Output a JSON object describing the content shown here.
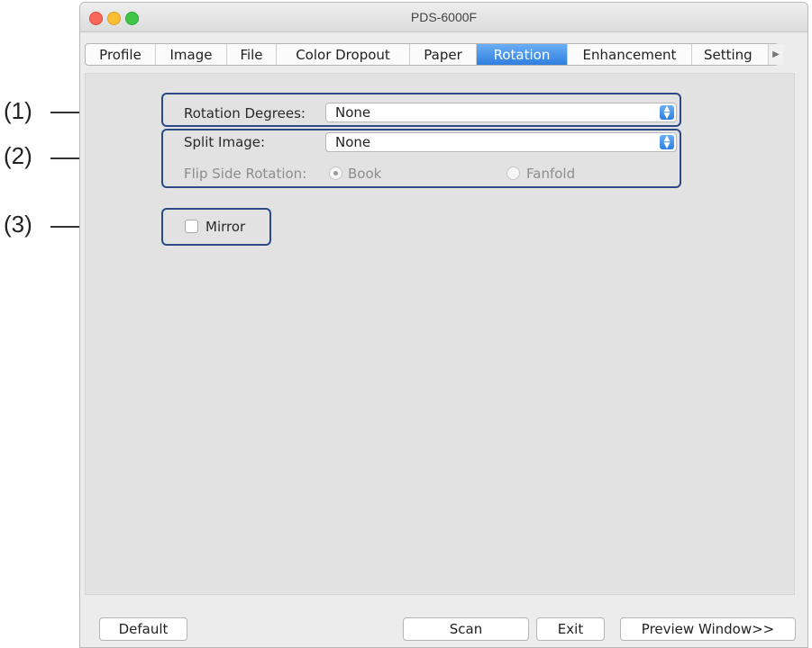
{
  "window": {
    "title": "PDS-6000F"
  },
  "tabs": [
    {
      "label": "Profile",
      "active": false
    },
    {
      "label": "Image",
      "active": false
    },
    {
      "label": "File",
      "active": false
    },
    {
      "label": "Color Dropout",
      "active": false
    },
    {
      "label": "Paper",
      "active": false
    },
    {
      "label": "Rotation",
      "active": true
    },
    {
      "label": "Enhancement",
      "active": false
    },
    {
      "label": "Setting",
      "active": false
    }
  ],
  "tab_scroll_icon": "right-arrow-icon",
  "callouts": [
    "(1)",
    "(2)",
    "(3)"
  ],
  "rotation": {
    "rotation_degrees_label": "Rotation Degrees:",
    "rotation_degrees_value": "None",
    "split_image_label": "Split Image:",
    "split_image_value": "None",
    "flip_side_label": "Flip Side Rotation:",
    "flip_side_options": [
      "Book",
      "Fanfold"
    ],
    "flip_side_selected": "Book",
    "mirror_label": "Mirror",
    "mirror_checked": false
  },
  "buttons": {
    "default": "Default",
    "scan": "Scan",
    "exit": "Exit",
    "preview": "Preview Window>>"
  },
  "colors": {
    "accent": "#2f7fe0",
    "highlight_box": "#2b4a86",
    "traffic_close": "#f8675c",
    "traffic_min": "#f9be33",
    "traffic_max": "#3fc649"
  }
}
